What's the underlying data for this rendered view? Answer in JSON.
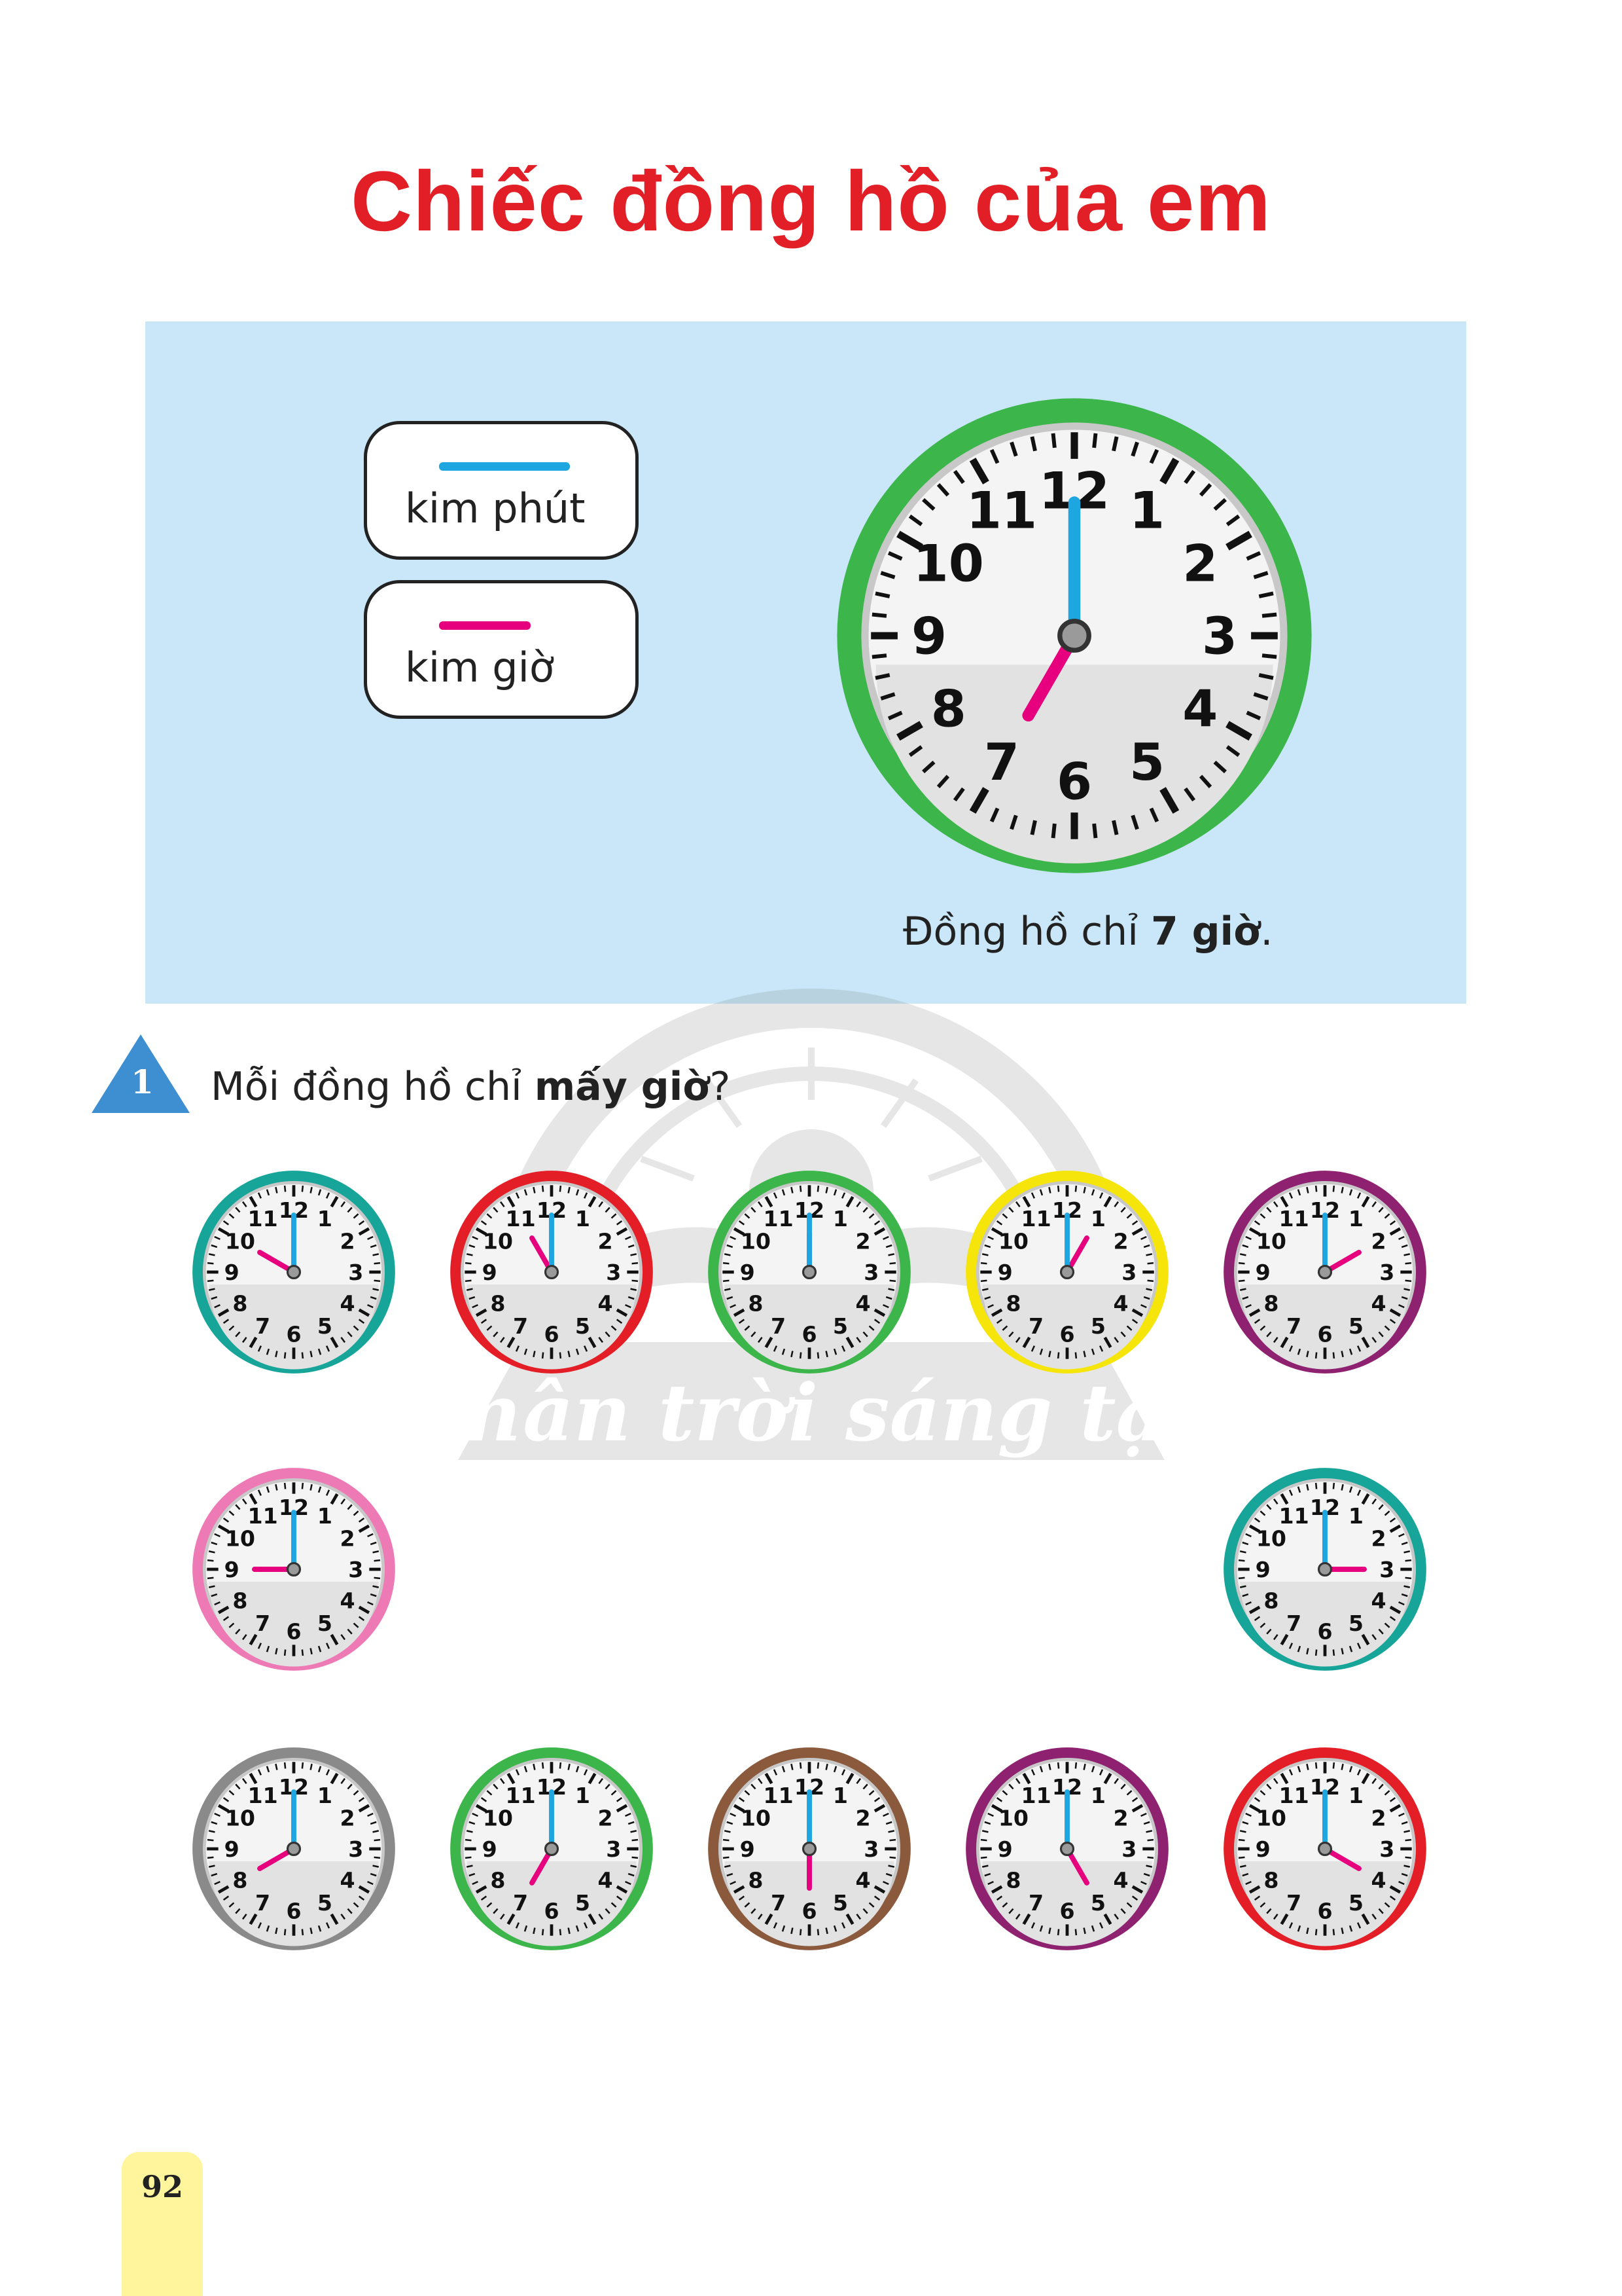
{
  "title": "Chiếc đồng hồ của em",
  "colors": {
    "title": "#e21f26",
    "panel_bg": "#c9e7f8",
    "minute_hand": "#1ea6e0",
    "hour_hand": "#e6007e",
    "exercise_badge": "#3d8fd1"
  },
  "legend": {
    "minute_label": "kim phút",
    "hour_label": "kim giờ"
  },
  "example": {
    "rim_color": "#3cb54a",
    "hour": 7,
    "minute": 0,
    "dial_numbers": [
      "12",
      "1",
      "2",
      "3",
      "4",
      "5",
      "6",
      "7",
      "8",
      "9",
      "10",
      "11"
    ],
    "caption_prefix": "Đồng hồ chỉ ",
    "caption_bold": "7 giờ",
    "caption_suffix": "."
  },
  "exercise": {
    "number": "1",
    "question_prefix": "Mỗi đồng hồ chỉ ",
    "question_bold": "mấy giờ",
    "question_suffix": "?",
    "clocks": [
      {
        "rim": "#17a59a",
        "hour": 10,
        "minute": 0
      },
      {
        "rim": "#e41e26",
        "hour": 11,
        "minute": 0
      },
      {
        "rim": "#3cb54a",
        "hour": 12,
        "minute": 0
      },
      {
        "rim": "#f5e50b",
        "hour": 1,
        "minute": 0
      },
      {
        "rim": "#8e2270",
        "hour": 2,
        "minute": 0
      },
      {
        "rim": "#ee7ab5",
        "hour": 9,
        "minute": 0
      },
      {
        "rim": "#17a59a",
        "hour": 3,
        "minute": 0
      },
      {
        "rim": "#8a8a8a",
        "hour": 8,
        "minute": 0
      },
      {
        "rim": "#3cb54a",
        "hour": 7,
        "minute": 0
      },
      {
        "rim": "#8b5a3c",
        "hour": 6,
        "minute": 0
      },
      {
        "rim": "#8e2270",
        "hour": 5,
        "minute": 0
      },
      {
        "rim": "#e41e26",
        "hour": 4,
        "minute": 0
      }
    ]
  },
  "watermark_text": "Chân trời sáng tạo",
  "page_number": "92"
}
